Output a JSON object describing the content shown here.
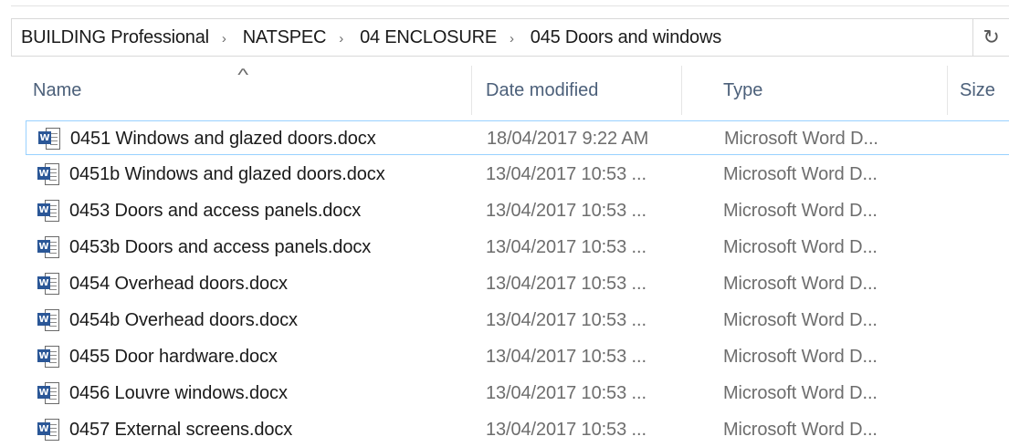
{
  "address": {
    "breadcrumbs": [
      "BUILDING Professional",
      "NATSPEC",
      "04 ENCLOSURE",
      "045 Doors and windows"
    ],
    "separator": "›",
    "refresh_icon": "↻"
  },
  "columns": {
    "name": "Name",
    "date": "Date modified",
    "type": "Type",
    "size": "Size",
    "sort_icon": "^"
  },
  "files": [
    {
      "name": "0451 Windows and glazed doors.docx",
      "date": "18/04/2017 9:22 AM",
      "type": "Microsoft Word D...",
      "selected": true
    },
    {
      "name": "0451b Windows and glazed doors.docx",
      "date": "13/04/2017 10:53 ...",
      "type": "Microsoft Word D..."
    },
    {
      "name": "0453 Doors and access panels.docx",
      "date": "13/04/2017 10:53 ...",
      "type": "Microsoft Word D..."
    },
    {
      "name": "0453b Doors and access panels.docx",
      "date": "13/04/2017 10:53 ...",
      "type": "Microsoft Word D..."
    },
    {
      "name": "0454 Overhead doors.docx",
      "date": "13/04/2017 10:53 ...",
      "type": "Microsoft Word D..."
    },
    {
      "name": "0454b Overhead doors.docx",
      "date": "13/04/2017 10:53 ...",
      "type": "Microsoft Word D..."
    },
    {
      "name": "0455 Door hardware.docx",
      "date": "13/04/2017 10:53 ...",
      "type": "Microsoft Word D..."
    },
    {
      "name": "0456 Louvre windows.docx",
      "date": "13/04/2017 10:53 ...",
      "type": "Microsoft Word D..."
    },
    {
      "name": "0457 External screens.docx",
      "date": "13/04/2017 10:53 ...",
      "type": "Microsoft Word D..."
    }
  ],
  "icon_badge": "W",
  "colors": {
    "header_text": "#4c607a",
    "selection_border": "#99d1ff",
    "word_blue": "#2b5797"
  }
}
